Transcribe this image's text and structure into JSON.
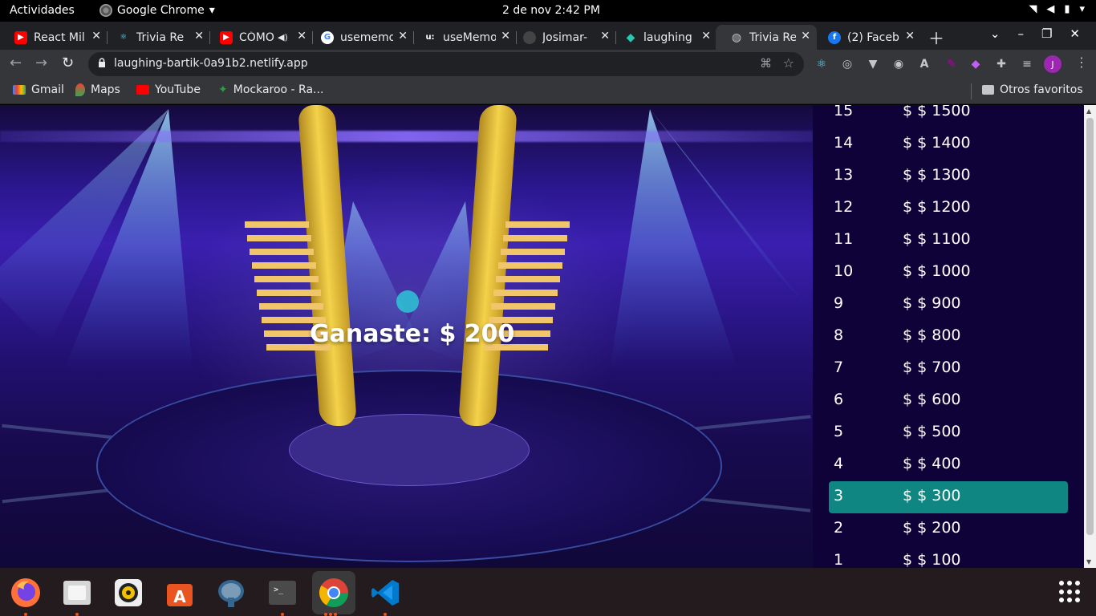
{
  "topbar": {
    "activities": "Actividades",
    "app_name": "Google Chrome",
    "clock": "2 de nov  2:42 PM"
  },
  "tabs": [
    {
      "title": "React Mil",
      "favicon": "youtube-icon",
      "color": "#ff0000"
    },
    {
      "title": "Trivia Re",
      "favicon": "react-icon",
      "color": "#61dafb"
    },
    {
      "title": "CÓMO",
      "favicon": "youtube-icon",
      "color": "#ff0000"
    },
    {
      "title": "usememo",
      "favicon": "google-icon",
      "color": "#4285f4"
    },
    {
      "title": "useMemo",
      "favicon": "u-icon",
      "color": "#ffffff"
    },
    {
      "title": "Josimar-",
      "favicon": "github-icon",
      "color": "#333333"
    },
    {
      "title": "laughing",
      "favicon": "netlify-icon",
      "color": "#25c7b7"
    },
    {
      "title": "Trivia Re",
      "favicon": "globe-icon",
      "color": "#9aa0a6",
      "active": true
    },
    {
      "title": "(2) Faceb",
      "favicon": "facebook-icon",
      "color": "#1877f2"
    }
  ],
  "omnibox": {
    "url": "laughing-bartik-0a91b2.netlify.app"
  },
  "avatar_letter": "J",
  "bookmarks": {
    "gmail": "Gmail",
    "maps": "Maps",
    "youtube": "YouTube",
    "mockaroo": "Mockaroo - Ra...",
    "other": "Otros favoritos"
  },
  "game": {
    "result_text": "Ganaste: $ 200",
    "active_step": 3,
    "active_color": "#0f8681",
    "prizes": [
      {
        "num": "15",
        "amount": "$ $ 1500"
      },
      {
        "num": "14",
        "amount": "$ $ 1400"
      },
      {
        "num": "13",
        "amount": "$ $ 1300"
      },
      {
        "num": "12",
        "amount": "$ $ 1200"
      },
      {
        "num": "11",
        "amount": "$ $ 1100"
      },
      {
        "num": "10",
        "amount": "$ $ 1000"
      },
      {
        "num": "9",
        "amount": "$ $ 900"
      },
      {
        "num": "8",
        "amount": "$ $ 800"
      },
      {
        "num": "7",
        "amount": "$ $ 700"
      },
      {
        "num": "6",
        "amount": "$ $ 600"
      },
      {
        "num": "5",
        "amount": "$ $ 500"
      },
      {
        "num": "4",
        "amount": "$ $ 400"
      },
      {
        "num": "3",
        "amount": "$ $ 300"
      },
      {
        "num": "2",
        "amount": "$ $ 200"
      },
      {
        "num": "1",
        "amount": "$ $ 100"
      }
    ]
  },
  "dock": [
    "firefox-icon",
    "files-icon",
    "rhythmbox-icon",
    "software-icon",
    "pgadmin-icon",
    "terminal-icon",
    "chrome-icon",
    "vscode-icon"
  ]
}
